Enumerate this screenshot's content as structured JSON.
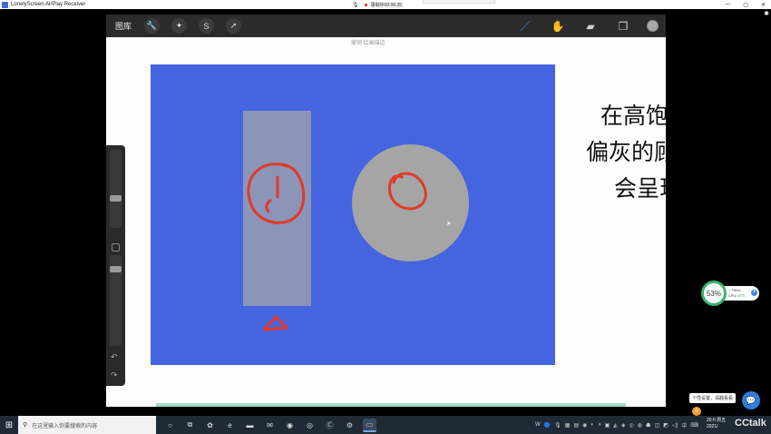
{
  "window": {
    "title": "LonelyScreen AirPlay Receiver",
    "recording_mic": "🎙",
    "recording_text": "录制中00:06:35",
    "minimize": "—",
    "maximize": "▢",
    "close": "✕",
    "settings_glyph": "✱"
  },
  "procreate": {
    "gallery_label": "图库",
    "toolbar_icons": [
      "wrench-icon",
      "magic-wand-icon",
      "selection-icon",
      "transform-icon"
    ],
    "toolbar_glyphs": [
      "🔧",
      "✦",
      "S",
      "➚"
    ],
    "right_tools": {
      "brush_glyph": "／",
      "smudge_glyph": "✋",
      "eraser_glyph": "▰",
      "layers_glyph": "❐"
    },
    "current_color": "#a8a8a8",
    "undo_label": "撤销 绘画描边",
    "handwriting": [
      "在高饱",
      "偏灰的顾",
      "会呈现"
    ],
    "side_undo": "↶",
    "side_redo": "↷"
  },
  "colors": {
    "canvas_blue": "#4565e0",
    "rect_gray": "#8c95b8",
    "circle_gray": "#a5a5a5",
    "stroke_red": "#e03a2a",
    "brush_active": "#3f8fe8"
  },
  "overlays": {
    "perf_percent": "53%",
    "perf_net": "↑  73K/s",
    "perf_cpu_label": "CPU",
    "perf_cpu_value": "65℃",
    "perf_plus": "+",
    "chat_tip": "个性设置，请戳看看",
    "chat_glyph": "💬",
    "cctalk_logo": "CCtalk",
    "tray_bubble": "5"
  },
  "taskbar": {
    "start_glyph": "⊞",
    "search_placeholder": "在这里输入你要搜索的内容",
    "search_glyph": "⚲",
    "apps": [
      {
        "name": "cortana",
        "glyph": "○",
        "active": false
      },
      {
        "name": "task-view",
        "glyph": "⧉",
        "active": false
      },
      {
        "name": "app-store",
        "glyph": "✿",
        "active": false
      },
      {
        "name": "edge-browser",
        "glyph": "e",
        "active": false
      },
      {
        "name": "file-explorer",
        "glyph": "▬",
        "active": false
      },
      {
        "name": "mail",
        "glyph": "✉",
        "active": false
      },
      {
        "name": "wechat",
        "glyph": "◉",
        "active": false
      },
      {
        "name": "chrome",
        "glyph": "◎",
        "active": false
      },
      {
        "name": "app-c",
        "glyph": "Ⓒ",
        "active": false
      },
      {
        "name": "settings",
        "glyph": "⚙",
        "active": false
      },
      {
        "name": "lonelyscreen",
        "glyph": "▭",
        "active": true
      }
    ],
    "tray": [
      "W",
      "🔵",
      "🎙",
      "▦",
      "▤",
      "◉",
      "◐",
      "◑",
      "▣",
      "◭",
      "◈",
      "◎",
      "◍",
      "☗",
      "◫",
      "◩",
      "◁)",
      "中",
      "⌨"
    ],
    "clock_time": "20:0",
    "clock_weekday": "周五",
    "clock_date": "2021/"
  }
}
